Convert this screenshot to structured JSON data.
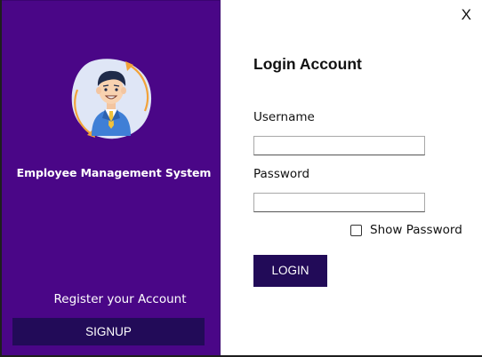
{
  "window": {
    "close_label": "X"
  },
  "left_panel": {
    "avatar_icon": "employee-avatar-icon",
    "app_title": "Employee Management System",
    "register_label": "Register your Account",
    "signup_label": "SIGNUP"
  },
  "login_form": {
    "title": "Login Account",
    "username_label": "Username",
    "username_value": "",
    "password_label": "Password",
    "password_value": "",
    "show_password_label": "Show Password",
    "show_password_checked": false,
    "login_label": "LOGIN"
  },
  "colors": {
    "sidebar_bg": "#4a0687",
    "button_bg": "#220b58",
    "form_bg": "#ffffff"
  }
}
